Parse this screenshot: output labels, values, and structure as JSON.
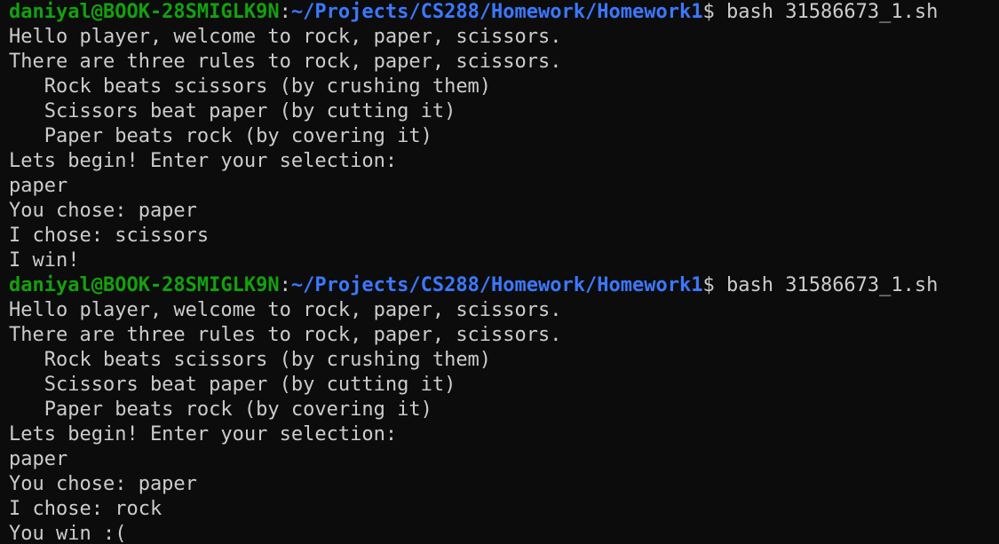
{
  "colors": {
    "background": "#0c0c0c",
    "foreground": "#cccccc",
    "prompt_user": "#13a10e",
    "prompt_path": "#3b78ff"
  },
  "sessions": [
    {
      "prompt": {
        "user_host": "daniyal@BOOK-28SMIGLK9N",
        "separator": ":",
        "path": "~/Projects/CS288/Homework/Homework1",
        "symbol": "$ ",
        "command": "bash 31586673_1.sh"
      },
      "output": [
        "Hello player, welcome to rock, paper, scissors.",
        "There are three rules to rock, paper, scissors.",
        "   Rock beats scissors (by crushing them)",
        "   Scissors beat paper (by cutting it)",
        "   Paper beats rock (by covering it)",
        "Lets begin! Enter your selection:",
        "paper",
        "You chose: paper",
        "I chose: scissors",
        "I win!"
      ]
    },
    {
      "prompt": {
        "user_host": "daniyal@BOOK-28SMIGLK9N",
        "separator": ":",
        "path": "~/Projects/CS288/Homework/Homework1",
        "symbol": "$ ",
        "command": "bash 31586673_1.sh"
      },
      "output": [
        "Hello player, welcome to rock, paper, scissors.",
        "There are three rules to rock, paper, scissors.",
        "   Rock beats scissors (by crushing them)",
        "   Scissors beat paper (by cutting it)",
        "   Paper beats rock (by covering it)",
        "Lets begin! Enter your selection:",
        "paper",
        "You chose: paper",
        "I chose: rock",
        "You win :("
      ]
    }
  ]
}
